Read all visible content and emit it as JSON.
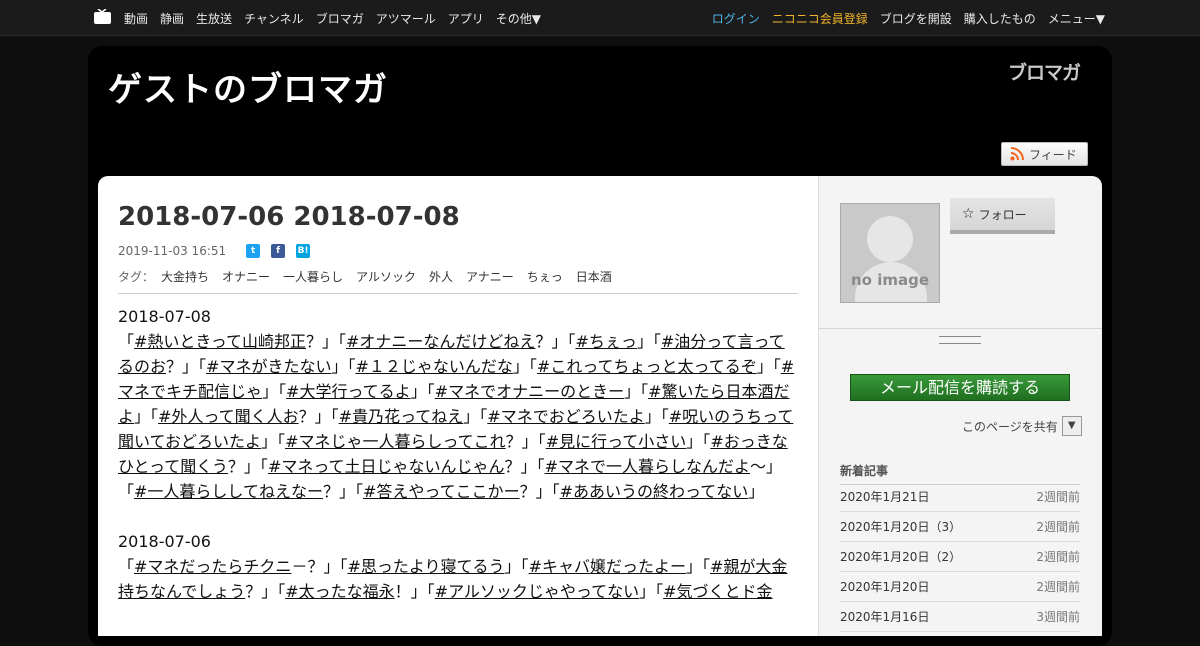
{
  "nav": {
    "left": [
      "動画",
      "静画",
      "生放送",
      "チャンネル",
      "ブロマガ",
      "アツマール",
      "アプリ",
      "その他▼"
    ],
    "right": {
      "login": "ログイン",
      "register": "ニコニコ会員登録",
      "open_blog": "ブログを開設",
      "purchased": "購入したもの",
      "menu": "メニュー▼"
    }
  },
  "blog": {
    "title": "ゲストのブロマガ",
    "logo_text": "ブロマガ",
    "feed_label": "フィード"
  },
  "article": {
    "title": "2018-07-06 2018-07-08",
    "date": "2019-11-03 16:51",
    "tags_label": "タグ：",
    "tags": [
      "大金持ち",
      "オナニー",
      "一人暮らし",
      "アルソック",
      "外人",
      "アナニー",
      "ちぇっ",
      "日本酒"
    ],
    "sections": [
      {
        "date": "2018-07-08",
        "items": [
          "#熱いときって山崎邦正",
          "？」「",
          "#オナニーなんだけどねえ",
          "？」「",
          "#ちぇっ",
          "」「",
          "#油分って言ってるのお",
          "？」「",
          "#マネがきたない",
          "」「",
          "#１２じゃないんだな",
          "」「",
          "#これってちょっと太ってるぞ",
          "」「",
          "#マネでキチ配信じゃ",
          "」「",
          "#大学行ってるよ",
          "」「",
          "#マネでオナニーのときー",
          "」「",
          "#驚いたら日本酒だよ",
          "」「",
          "#外人って聞く人お",
          "？」「",
          "#貴乃花ってねえ",
          "」「",
          "#マネでおどろいたよ",
          "」「",
          "#呪いのうちって聞いておどろいたよ",
          "」「",
          "#マネじゃ一人暮らしってこれ",
          "？」「",
          "#見に行って小さい",
          "」「",
          "#おっきなひとって聞くう",
          "？」「",
          "#マネって土日じゃないんじゃん",
          "？」「",
          "#マネで一人暮らしなんだよ",
          "～」「",
          "#一人暮らししてねえなー",
          "？」「",
          "#答えやってここかー",
          "？」「",
          "#ああいうの終わってない",
          "」"
        ]
      },
      {
        "date": "2018-07-06",
        "items": [
          "#マネだったらチクニ",
          "－？」「",
          "#思ったより寝てるう",
          "」「",
          "#キャバ嬢だったよー",
          "」「",
          "#親が大金持ちなんでしょう",
          "？」「",
          "#太ったな福永",
          "！」「",
          "#アルソックじゃやってない",
          "」「",
          "#気づくとド金"
        ]
      }
    ]
  },
  "sidebar": {
    "noimage": "no image",
    "follow": "フォロー",
    "subscribe": "メール配信を購読する",
    "share_page": "このページを共有",
    "recent_heading": "新着記事",
    "recent": [
      {
        "title": "2020年1月21日",
        "ago": "2週間前"
      },
      {
        "title": "2020年1月20日（3）",
        "ago": "2週間前"
      },
      {
        "title": "2020年1月20日（2）",
        "ago": "2週間前"
      },
      {
        "title": "2020年1月20日",
        "ago": "2週間前"
      },
      {
        "title": "2020年1月16日",
        "ago": "3週間前"
      }
    ]
  },
  "colors": {
    "login": "#4fb3e8",
    "register": "#f0b429",
    "subscribe": "#2a852a"
  }
}
